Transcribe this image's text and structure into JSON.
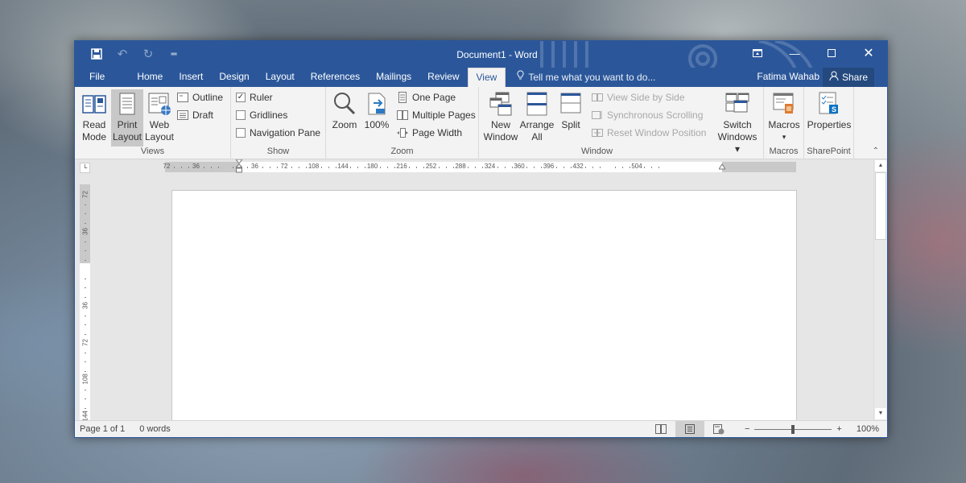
{
  "window": {
    "title": "Document1 - Word",
    "accent_color": "#2b579a"
  },
  "qat": {
    "save_icon": "save-icon",
    "undo_icon": "undo-icon",
    "redo_icon": "redo-icon",
    "customize_icon": "customize-qat-icon"
  },
  "tabs": [
    {
      "label": "File"
    },
    {
      "label": "Home"
    },
    {
      "label": "Insert"
    },
    {
      "label": "Design"
    },
    {
      "label": "Layout"
    },
    {
      "label": "References"
    },
    {
      "label": "Mailings"
    },
    {
      "label": "Review"
    },
    {
      "label": "View",
      "active": true
    }
  ],
  "tellme": {
    "placeholder": "Tell me what you want to do..."
  },
  "user": {
    "name": "Fatima Wahab"
  },
  "share": {
    "label": "Share"
  },
  "ribbon": {
    "views": {
      "label": "Views",
      "read_mode": [
        "Read",
        "Mode"
      ],
      "print_layout": [
        "Print",
        "Layout"
      ],
      "web_layout": [
        "Web",
        "Layout"
      ],
      "outline": "Outline",
      "draft": "Draft"
    },
    "show": {
      "label": "Show",
      "ruler": {
        "label": "Ruler",
        "checked": true
      },
      "gridlines": {
        "label": "Gridlines",
        "checked": false
      },
      "navigation_pane": {
        "label": "Navigation Pane",
        "checked": false
      }
    },
    "zoom": {
      "label": "Zoom",
      "zoom_btn": "Zoom",
      "hundred_btn": "100%",
      "one_page": "One Page",
      "multiple_pages": "Multiple Pages",
      "page_width": "Page Width"
    },
    "window_group": {
      "label": "Window",
      "new_window": [
        "New",
        "Window"
      ],
      "arrange_all": [
        "Arrange",
        "All"
      ],
      "split": "Split",
      "view_side_by_side": "View Side by Side",
      "synchronous_scrolling": "Synchronous Scrolling",
      "reset_window_position": "Reset Window Position",
      "switch_windows": [
        "Switch",
        "Windows ▾"
      ]
    },
    "macros": {
      "label": "Macros",
      "macros_btn": "Macros",
      "dropdown": "▾"
    },
    "sharepoint": {
      "label": "SharePoint",
      "properties": "Properties"
    }
  },
  "ruler": {
    "horizontal_labels": [
      "72",
      "36",
      "",
      "36",
      "72",
      "108",
      "144",
      "180",
      "216",
      "252",
      "288",
      "324",
      "360",
      "396",
      "432",
      "",
      "504"
    ],
    "vertical_labels": [
      "72",
      "36",
      "",
      "36",
      "72",
      "108",
      "144"
    ]
  },
  "status": {
    "page": "Page 1 of 1",
    "words": "0 words",
    "zoom_percent": "100%",
    "zoom_level": 100
  }
}
